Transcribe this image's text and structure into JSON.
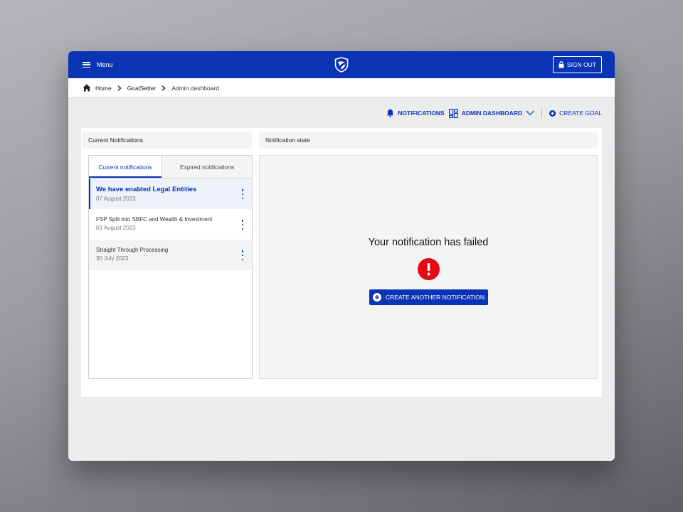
{
  "header": {
    "menu_label": "Menu",
    "signout_label": "SIGN OUT"
  },
  "breadcrumb": {
    "items": [
      "Home",
      "GoalSetter",
      "Admin dashboard"
    ]
  },
  "actions": {
    "notifications": "NOTIFICATIONS",
    "admin_dashboard": "ADMIN DASHBOARD",
    "create_goal": "CREATE GOAL"
  },
  "notifications_panel": {
    "heading": "Current Notifications",
    "tabs": [
      "Current notifications",
      "Expired notifications"
    ],
    "items": [
      {
        "title": "We have enabled Legal Entities",
        "date": "07 August 2023"
      },
      {
        "title": "FSP Split into SBFC and Wealth & Investment",
        "date": "03 August 2023"
      },
      {
        "title": "Straight Through Processing",
        "date": "30 July 2023"
      }
    ]
  },
  "state_panel": {
    "heading": "Notification state",
    "message": "Your notification has failed",
    "button_label": "CREATE ANOTHER NOTIFICATION"
  },
  "colors": {
    "brand_blue": "#0a34b4",
    "error_red": "#e50914"
  }
}
